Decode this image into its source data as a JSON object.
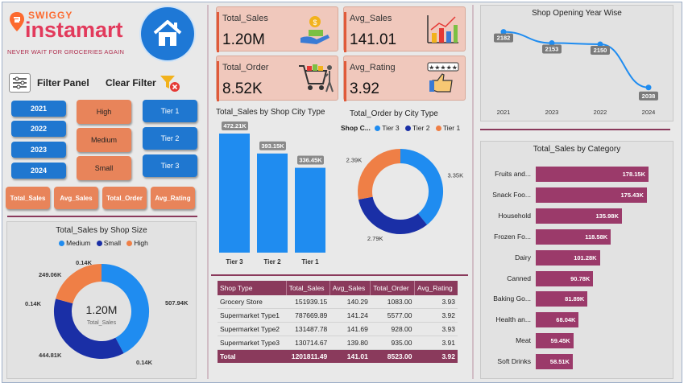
{
  "brand": {
    "name_top": "SWIGGY",
    "name_main": "instamart",
    "tagline": "NEVER WAIT FOR GROCERIES AGAIN"
  },
  "filters": {
    "title": "Filter Panel",
    "clear_label": "Clear Filter",
    "years": [
      "2021",
      "2022",
      "2023",
      "2024"
    ],
    "sizes": [
      "High",
      "Medium",
      "Small"
    ],
    "tiers": [
      "Tier 1",
      "Tier 2",
      "Tier 3"
    ],
    "measures": [
      "Total_Sales",
      "Avg_Sales",
      "Total_Order",
      "Avg_Rating"
    ]
  },
  "kpis": [
    {
      "label": "Total_Sales",
      "value": "1.20M",
      "icon": "money-hand-icon"
    },
    {
      "label": "Avg_Sales",
      "value": "141.01",
      "icon": "bar-chart-icon"
    },
    {
      "label": "Total_Order",
      "value": "8.52K",
      "icon": "shopping-cart-icon"
    },
    {
      "label": "Avg_Rating",
      "value": "3.92",
      "icon": "thumbs-up-rating-icon"
    }
  ],
  "colors": {
    "accent": "#8a3a5c",
    "tier1": "#ef7f46",
    "tier2": "#1a2fa6",
    "tier3": "#1f8cf0",
    "bar": "#9b3a6a",
    "button_blue": "#1f77d0"
  },
  "shop_size_donut": {
    "title": "Total_Sales by Shop Size",
    "legend": [
      "Medium",
      "Small",
      "High"
    ],
    "center_value": "1.20M",
    "center_label": "Total_Sales",
    "labels": [
      "507.94K",
      "444.81K",
      "249.06K",
      "0.14K",
      "0.14K",
      "0.14K"
    ]
  },
  "city_bar": {
    "title": "Total_Sales by Shop City Type"
  },
  "city_donut": {
    "title": "Total_Order by City Type",
    "legend_title": "Shop C...",
    "legend": [
      "Tier 3",
      "Tier 2",
      "Tier 1"
    ],
    "labels": [
      "3.35K",
      "2.79K",
      "2.39K"
    ]
  },
  "table": {
    "headers": [
      "Shop Type",
      "Total_Sales",
      "Avg_Sales",
      "Total_Order",
      "Avg_Rating"
    ],
    "rows": [
      [
        "Grocery Store",
        "151939.15",
        "140.29",
        "1083.00",
        "3.93"
      ],
      [
        "Supermarket Type1",
        "787669.89",
        "141.24",
        "5577.00",
        "3.92"
      ],
      [
        "Supermarket Type2",
        "131487.78",
        "141.69",
        "928.00",
        "3.93"
      ],
      [
        "Supermarket Type3",
        "130714.67",
        "139.80",
        "935.00",
        "3.91"
      ]
    ],
    "total": [
      "Total",
      "1201811.49",
      "141.01",
      "8523.00",
      "3.92"
    ]
  },
  "year_line": {
    "title": "Shop Opening Year Wise"
  },
  "category_bar": {
    "title": "Total_Sales by Category"
  },
  "chart_data": [
    {
      "type": "bar",
      "title": "Total_Sales by Shop City Type",
      "categories": [
        "Tier 3",
        "Tier 2",
        "Tier 1"
      ],
      "values": [
        472210,
        393150,
        336450
      ],
      "labels": [
        "472.21K",
        "393.15K",
        "336.45K"
      ]
    },
    {
      "type": "pie",
      "title": "Total_Order by City Type",
      "categories": [
        "Tier 3",
        "Tier 2",
        "Tier 1"
      ],
      "values": [
        3350,
        2790,
        2390
      ],
      "labels": [
        "3.35K",
        "2.79K",
        "2.39K"
      ]
    },
    {
      "type": "pie",
      "title": "Total_Sales by Shop Size",
      "categories": [
        "Medium",
        "Small",
        "High"
      ],
      "values": [
        507940,
        444810,
        249060
      ]
    },
    {
      "type": "line",
      "title": "Shop Opening Year Wise",
      "x": [
        "2021",
        "2023",
        "2022",
        "2024"
      ],
      "values": [
        2182,
        2153,
        2150,
        2038
      ],
      "labels": [
        "2182",
        "2153",
        "2150",
        "2038"
      ]
    },
    {
      "type": "bar",
      "title": "Total_Sales by Category",
      "categories": [
        "Fruits and...",
        "Snack Foo...",
        "Household",
        "Frozen Fo...",
        "Dairy",
        "Canned",
        "Baking Go...",
        "Health an...",
        "Meat",
        "Soft Drinks"
      ],
      "values": [
        178150,
        175430,
        135980,
        118580,
        101280,
        90780,
        81890,
        68040,
        59450,
        58510
      ],
      "labels": [
        "178.15K",
        "175.43K",
        "135.98K",
        "118.58K",
        "101.28K",
        "90.78K",
        "81.89K",
        "68.04K",
        "59.45K",
        "58.51K"
      ]
    }
  ]
}
